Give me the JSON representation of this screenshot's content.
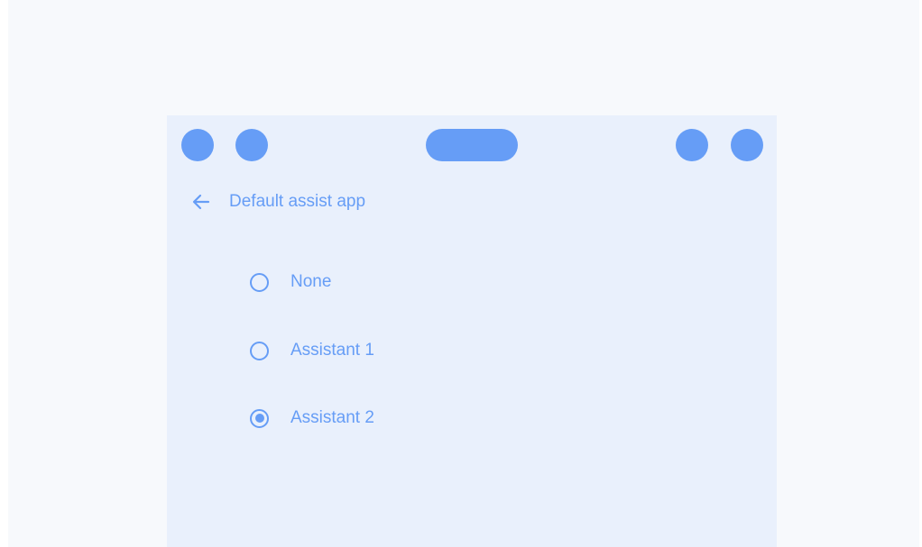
{
  "screen": {
    "title": "Default assist app",
    "back_icon": "arrow-left-icon"
  },
  "options": [
    {
      "label": "None",
      "selected": false
    },
    {
      "label": "Assistant 1",
      "selected": false
    },
    {
      "label": "Assistant 2",
      "selected": true
    }
  ],
  "colors": {
    "accent": "#669df6",
    "screen_background": "#e9f0fc",
    "page_background": "#f7f9fc"
  }
}
